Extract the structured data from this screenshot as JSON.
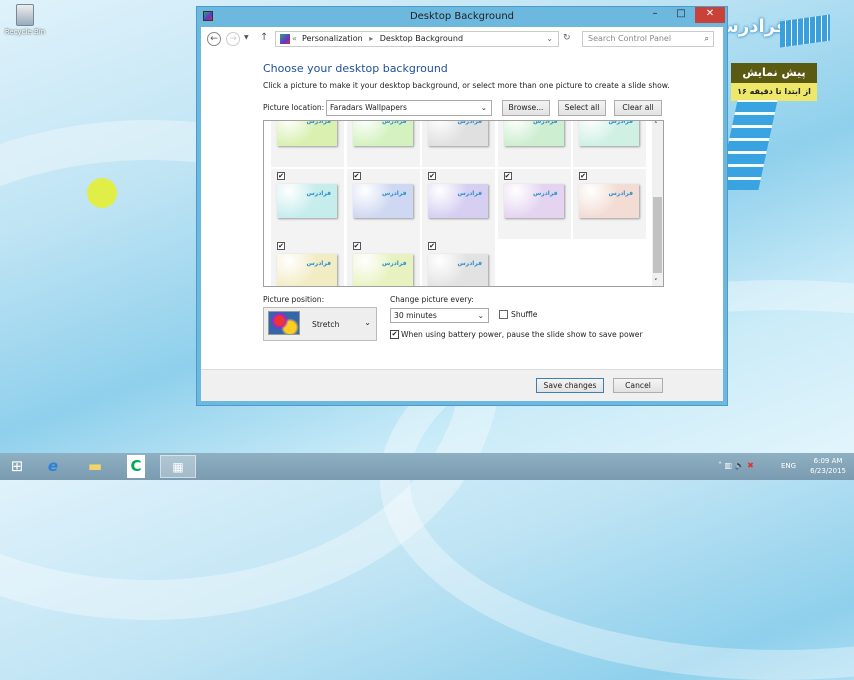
{
  "desktop": {
    "recycle_bin": "Recycle Bin"
  },
  "window": {
    "title": "Desktop Background",
    "minimize": "–",
    "maximize": "□",
    "close": "✕"
  },
  "address": {
    "crumb_prefix": "«",
    "crumbs": [
      "Personalization",
      "Desktop Background"
    ],
    "separator": "▸",
    "search_placeholder": "Search Control Panel"
  },
  "main": {
    "heading": "Choose your desktop background",
    "description": "Click a picture to make it your desktop background, or select more than one picture to create a slide show.",
    "location_label": "Picture location:",
    "location_value": "Faradars Wallpapers",
    "browse": "Browse...",
    "select_all": "Select all",
    "clear_all": "Clear all"
  },
  "grid": {
    "watermark": "فرادرس",
    "tiles": [
      {
        "color": "#d9f0b0",
        "checked": null
      },
      {
        "color": "#d4f2c0",
        "checked": null
      },
      {
        "color": "#e0e0e0",
        "checked": null
      },
      {
        "color": "#cdeed0",
        "checked": null
      },
      {
        "color": "#d0f0e4",
        "checked": null
      },
      {
        "color": "#c6ecec",
        "checked": true
      },
      {
        "color": "#cfd8f2",
        "checked": true
      },
      {
        "color": "#d6cff2",
        "checked": true
      },
      {
        "color": "#e4d4f0",
        "checked": true
      },
      {
        "color": "#f2dcd4",
        "checked": true
      },
      {
        "color": "#f2ecc4",
        "checked": true
      },
      {
        "color": "#e8f2c0",
        "checked": true
      },
      {
        "color": "#e2e2e2",
        "checked": true
      }
    ]
  },
  "position": {
    "label": "Picture position:",
    "value": "Stretch"
  },
  "interval": {
    "label": "Change picture every:",
    "value": "30 minutes",
    "shuffle": "Shuffle",
    "shuffle_checked": false,
    "battery": "When using battery power, pause the slide show to save power",
    "battery_checked": true
  },
  "footer": {
    "save": "Save changes",
    "cancel": "Cancel"
  },
  "branding": {
    "logo": "فرادرس",
    "promo_title": "پیش نمایش",
    "promo_sub": "از ابتدا تا دقیقه ۱۶"
  },
  "taskbar": {
    "lang": "ENG",
    "time": "6:09 AM",
    "date": "6/23/2015"
  }
}
